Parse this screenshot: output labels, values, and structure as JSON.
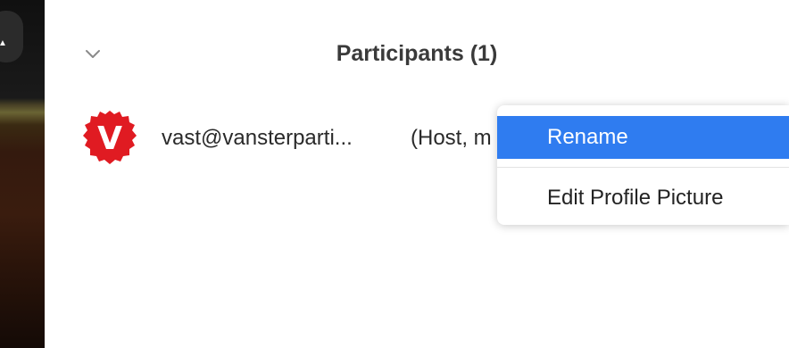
{
  "panel": {
    "title": "Participants (1)"
  },
  "participants": [
    {
      "avatar_letter": "V",
      "avatar_color": "#e01b22",
      "name": "vast@vansterparti...",
      "role": "(Host, m"
    }
  ],
  "context_menu": {
    "items": [
      {
        "label": "Rename",
        "highlighted": true
      },
      {
        "label": "Edit Profile Picture",
        "highlighted": false
      }
    ],
    "highlight_color": "#2f7cf0"
  },
  "icons": {
    "collapse": "chevron-down-icon",
    "camera": "camera-icon"
  }
}
